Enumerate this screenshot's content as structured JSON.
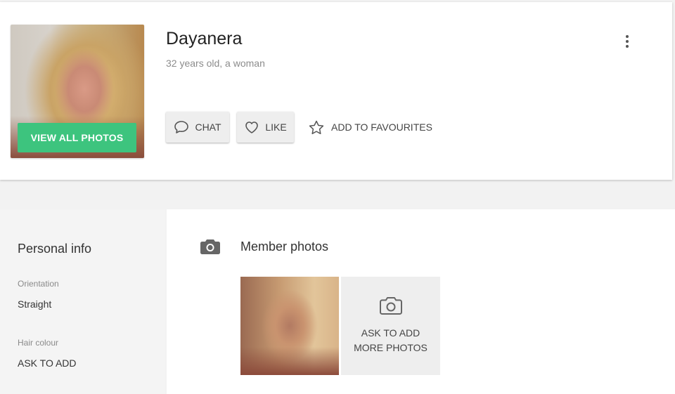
{
  "profile": {
    "name": "Dayanera",
    "subtitle": "32 years old, a woman",
    "view_photos_label": "VIEW ALL PHOTOS",
    "actions": {
      "chat_label": "CHAT",
      "like_label": "LIKE",
      "favourite_label": "ADD TO FAVOURITES"
    },
    "menu_icon": "more-vertical-icon"
  },
  "sidebar": {
    "title": "Personal info",
    "fields": [
      {
        "label": "Orientation",
        "value": "Straight"
      },
      {
        "label": "Hair colour",
        "value": "ASK TO ADD"
      }
    ]
  },
  "photos": {
    "section_title": "Member photos",
    "section_icon": "camera-icon",
    "ask_more_label": "ASK TO ADD\nMORE PHOTOS"
  },
  "colors": {
    "accent_green": "#3dc47e",
    "button_grey": "#eeeeee",
    "muted_text": "#8c8c8c"
  }
}
